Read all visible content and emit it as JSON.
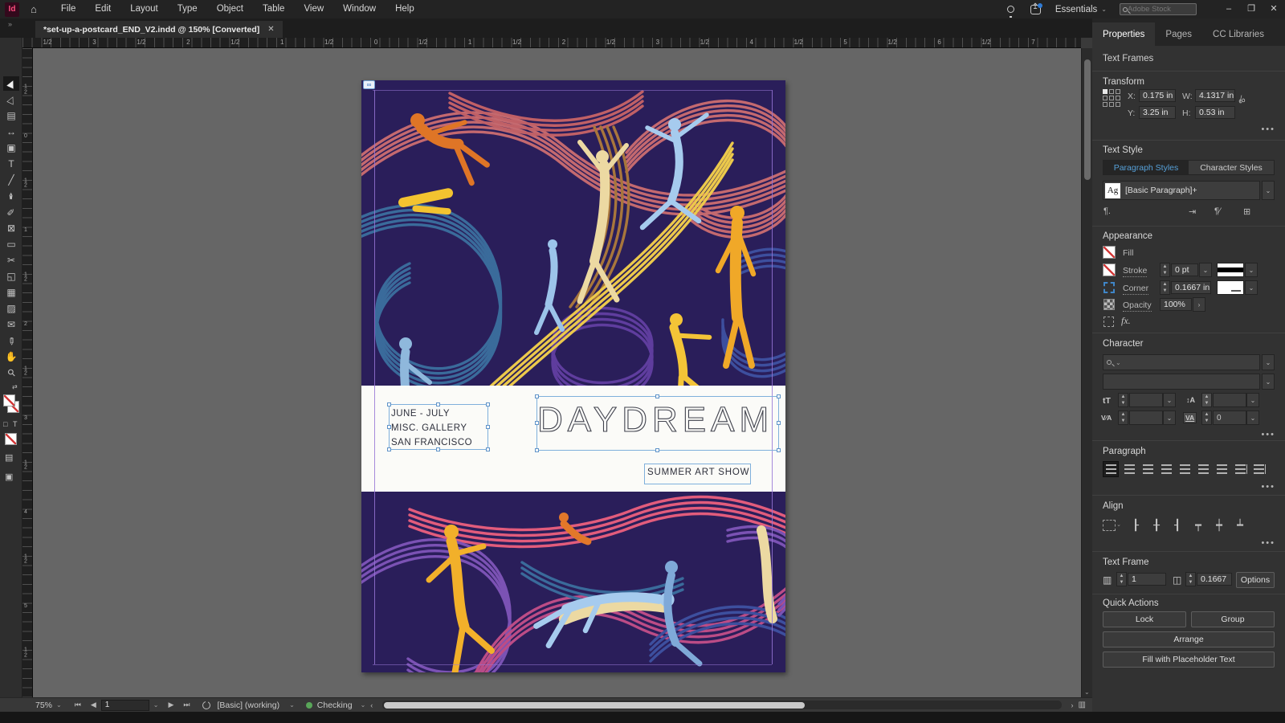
{
  "menubar": {
    "logo": "Id",
    "menus": [
      {
        "label": "File"
      },
      {
        "label": "Edit"
      },
      {
        "label": "Layout"
      },
      {
        "label": "Type"
      },
      {
        "label": "Object"
      },
      {
        "label": "Table"
      },
      {
        "label": "View"
      },
      {
        "label": "Window"
      },
      {
        "label": "Help"
      }
    ],
    "workspace": "Essentials",
    "search_placeholder": "Adobe Stock",
    "window_buttons": {
      "minimize": "–",
      "restore": "❐",
      "close": "✕"
    }
  },
  "tabbar": {
    "doc_title": "*set-up-a-postcard_END_V2.indd @ 150% [Converted]",
    "close": "✕",
    "overflow": "»"
  },
  "tools": [
    {
      "name": "selection",
      "glyph": "▶",
      "rot": -65,
      "active": true
    },
    {
      "name": "direct-selection",
      "glyph": "▷",
      "rot": -65
    },
    {
      "name": "page",
      "glyph": "▤"
    },
    {
      "name": "gap",
      "glyph": "↔"
    },
    {
      "name": "content-collector",
      "glyph": "▣"
    },
    {
      "name": "type",
      "glyph": "T"
    },
    {
      "name": "line",
      "glyph": "╱"
    },
    {
      "name": "pen",
      "glyph": "✒",
      "rot": -90
    },
    {
      "name": "pencil",
      "glyph": "✎",
      "rot": -90
    },
    {
      "name": "frame",
      "glyph": "⊠"
    },
    {
      "name": "rectangle",
      "glyph": "▭"
    },
    {
      "name": "scissors",
      "glyph": "✂"
    },
    {
      "name": "free-transform",
      "glyph": "◱"
    },
    {
      "name": "gradient",
      "glyph": "▦"
    },
    {
      "name": "gradient-feather",
      "glyph": "▨"
    },
    {
      "name": "note",
      "glyph": "✉"
    },
    {
      "name": "eyedropper",
      "glyph": "✐",
      "rot": 135
    },
    {
      "name": "hand",
      "glyph": "✋"
    },
    {
      "name": "zoom",
      "glyph": "⚲",
      "rot": -45
    }
  ],
  "rulers": {
    "horizontal": [
      "1/2",
      "3",
      "1/2",
      "2",
      "1/2",
      "1",
      "1/2",
      "0",
      "1/2",
      "1",
      "1/2",
      "2",
      "1/2",
      "3",
      "1/2",
      "4",
      "1/2",
      "5",
      "1/2",
      "6",
      "1/2",
      "7"
    ],
    "vertical": [
      "1\n2",
      "0",
      "1\n2",
      "1",
      "1\n2",
      "2",
      "1\n2",
      "3",
      "1\n2",
      "4",
      "1\n2",
      "5",
      "1\n2",
      "6"
    ]
  },
  "artboard": {
    "link_badge": "∞",
    "dates_lines": "JUNE - JULY\nMISC. GALLERY\nSAN FRANCISCO",
    "title": "DAYDREAM",
    "subtitle": "SUMMER ART SHOW",
    "colors": {
      "background": "#2a1e5a",
      "band": "#fbfbf8",
      "salmon": "#c4696f",
      "steel_blue": "#3a6b9b",
      "yellow": "#ecc94b",
      "gold": "#f0a828",
      "magenta": "#bc4c86",
      "purple": "#5f3d9e",
      "violet": "#7b52b4",
      "indigo": "#3d4f9e",
      "pink": "#e25c7c",
      "cream": "#ecd9a2",
      "light_blue": "#a6cbee",
      "orange": "#df7526"
    }
  },
  "panel": {
    "tabs": [
      {
        "label": "Properties",
        "name": "properties",
        "active": true
      },
      {
        "label": "Pages",
        "name": "pages"
      },
      {
        "label": "CC Libraries",
        "name": "cc-libraries"
      }
    ],
    "context_label": "Text Frames",
    "transform": {
      "title": "Transform",
      "x_label": "X:",
      "x_value": "0.175 in",
      "y_label": "Y:",
      "y_value": "3.25 in",
      "w_label": "W:",
      "w_value": "4.1317 in",
      "h_label": "H:",
      "h_value": "0.53 in",
      "more": "•••"
    },
    "text_style": {
      "title": "Text Style",
      "tabs": [
        {
          "label": "Paragraph Styles",
          "name": "paragraph-styles",
          "active": true
        },
        {
          "label": "Character Styles",
          "name": "character-styles"
        }
      ],
      "style_badge": "Ag",
      "style_name": "[Basic Paragraph]+",
      "icons": {
        "pilcrow": "¶.",
        "redefine": "⇥",
        "clear_overrides": "¶⁄",
        "new_style": "⊞"
      }
    },
    "appearance": {
      "title": "Appearance",
      "fill_label": "Fill",
      "stroke_label": "Stroke",
      "stroke_value": "0 pt",
      "corner_label": "Corner",
      "corner_value": "0.1667 in",
      "opacity_label": "Opacity",
      "opacity_value": "100%",
      "opacity_more": "›",
      "fx_label": "fx.",
      "more": "•••"
    },
    "character": {
      "title": "Character",
      "font_family_value": "",
      "font_style_value": "",
      "size_icon": "tT",
      "leading_icon": "↕A",
      "kerning_icon": "V⁄A",
      "tracking_icon": "VA",
      "size_value": "",
      "leading_value": "",
      "kerning_value": "",
      "tracking_value": "0",
      "more": "•••"
    },
    "paragraph": {
      "title": "Paragraph",
      "buttons": [
        {
          "name": "align-left",
          "active": true
        },
        {
          "name": "align-center"
        },
        {
          "name": "align-right"
        },
        {
          "name": "justify-left"
        },
        {
          "name": "justify-center"
        },
        {
          "name": "justify-right"
        },
        {
          "name": "justify-all"
        },
        {
          "name": "align-toward-spine",
          "bar": true
        },
        {
          "name": "align-away-from-spine",
          "bar": true
        }
      ],
      "more": "•••"
    },
    "align": {
      "title": "Align",
      "buttons": [
        {
          "name": "align-left",
          "glyph": "┠"
        },
        {
          "name": "align-h-center",
          "glyph": "╂"
        },
        {
          "name": "align-right",
          "glyph": "┨"
        },
        {
          "name": "align-top",
          "glyph": "┯"
        },
        {
          "name": "align-v-center",
          "glyph": "┿"
        },
        {
          "name": "align-bottom",
          "glyph": "┷"
        }
      ],
      "more": "•••"
    },
    "text_frame": {
      "title": "Text Frame",
      "columns_value": "1",
      "gutter_value": "0.1667",
      "options_label": "Options"
    },
    "quick_actions": {
      "title": "Quick Actions",
      "lock_label": "Lock",
      "group_label": "Group",
      "arrange_label": "Arrange",
      "fill_placeholder_label": "Fill with Placeholder Text"
    }
  },
  "statusbar": {
    "zoom": "75%",
    "nav": {
      "first": "⏮",
      "prev": "◀",
      "next": "▶",
      "last": "⏭"
    },
    "page_value": "1",
    "preset": "[Basic] (working)",
    "check_label": "Checking",
    "scroll_left": "‹",
    "scroll_right": "›",
    "spread_icon": "▥"
  }
}
